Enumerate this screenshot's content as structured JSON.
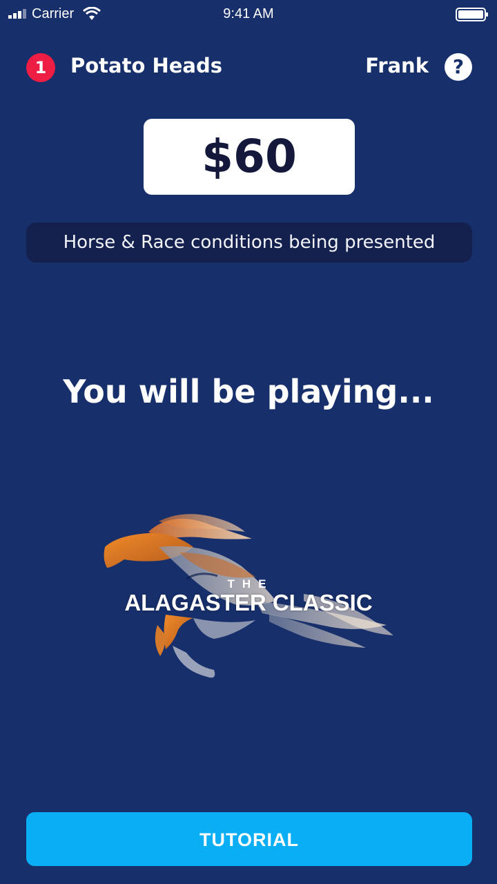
{
  "status_bar": {
    "carrier": "Carrier",
    "time": "9:41 AM"
  },
  "header": {
    "team_rank": "1",
    "team_name": "Potato Heads",
    "user_name": "Frank",
    "help_icon": "?"
  },
  "amount": "$60",
  "status_message": "Horse & Race conditions being presented",
  "heading": "You will be playing...",
  "event_logo": {
    "the": "THE",
    "title": "ALAGASTER CLASSIC"
  },
  "tutorial_label": "TUTORIAL",
  "colors": {
    "background": "#172f6b",
    "badge": "#ee1d43",
    "button": "#0aaef4",
    "pill": "#14214e"
  }
}
